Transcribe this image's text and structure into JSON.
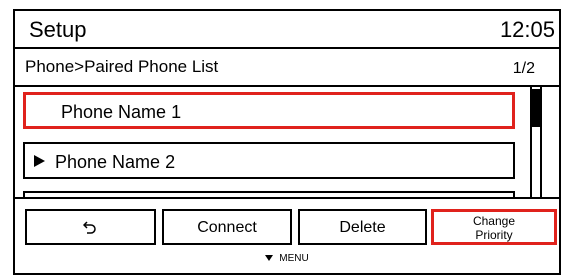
{
  "header": {
    "title": "Setup",
    "time": "12:05"
  },
  "breadcrumb": {
    "path": "Phone>Paired Phone List",
    "page_indicator": "1/2"
  },
  "phone_list": [
    {
      "label": "Phone Name 1",
      "selected": true
    },
    {
      "label": "Phone Name 2",
      "selected": false,
      "has_arrow": true
    },
    {
      "label": "",
      "selected": false
    }
  ],
  "menu": {
    "buttons": [
      {
        "label": "",
        "icon": "back-arrow-icon"
      },
      {
        "label": "Connect"
      },
      {
        "label": "Delete"
      },
      {
        "label": "Change Priority",
        "line1": "Change",
        "line2": "Priority",
        "selected": true
      }
    ],
    "hint": "MENU"
  },
  "colors": {
    "selection": "#e0221c",
    "border": "#000000",
    "background": "#ffffff"
  }
}
